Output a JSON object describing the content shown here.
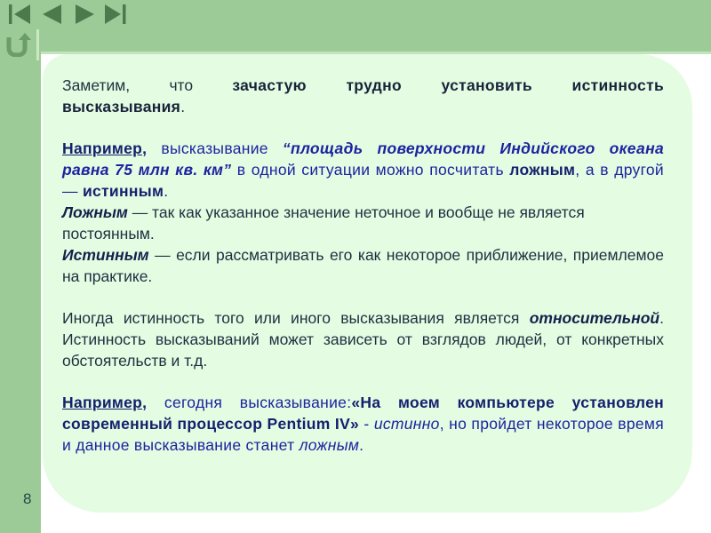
{
  "nav": {
    "buttons": [
      {
        "name": "first-slide-button",
        "icon": "skip-back-icon"
      },
      {
        "name": "previous-slide-button",
        "icon": "triangle-left-icon"
      },
      {
        "name": "next-slide-button",
        "icon": "triangle-right-icon"
      },
      {
        "name": "last-slide-button",
        "icon": "skip-forward-icon"
      }
    ],
    "return_icon": "return-arrow-icon",
    "icon_color": "#4c7a4c"
  },
  "colors": {
    "header_green": "#9dcb98",
    "panel_green": "#e4fce2",
    "text_blue": "#1c23a0",
    "text_dark": "#1f2f40"
  },
  "slide": {
    "number": "8",
    "p1": {
      "a": "Заметим, что ",
      "b": "зачастую трудно установить истинность высказывания",
      "c": "."
    },
    "p2": {
      "label": "Например,",
      "a": " высказывание ",
      "quote": "“площадь поверхности Индийского океана равна 75 млн кв. км”",
      "b": " в одной ситуации можно посчитать ",
      "false_word": "ложным",
      "c": ", а в другой — ",
      "true_word": "истинным",
      "d": "."
    },
    "p3": {
      "term": "Ложным",
      "text": " — так как указанное значение неточное и вообще не является постоянным."
    },
    "p4": {
      "term": "Истинным",
      "text": " — если рассматривать его как некоторое приближение, приемлемое на практике."
    },
    "p5": {
      "a": "Иногда истинность того или иного высказывания является ",
      "term": "относительной",
      "b": ". Истинность высказываний может зависеть от взглядов людей, от конкретных обстоятельств и т.д."
    },
    "p6": {
      "label": "Например,",
      "a": " сегодня высказывание:",
      "quote": "«На моем компьютере установлен современный процессор Pentium IV»",
      "b": "  - ",
      "true_word": "истинно",
      "c": ", но пройдет некоторое время и данное высказывание станет ",
      "false_word": "ложным",
      "d": "."
    }
  }
}
